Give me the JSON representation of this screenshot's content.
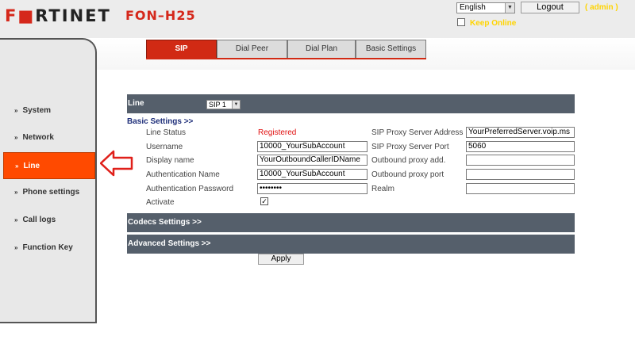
{
  "header": {
    "logo_main": "F",
    "logo_mid": "RTINET",
    "model": "FON–H25",
    "language": "English",
    "logout_label": "Logout",
    "user": "( admin )",
    "keep_online_label": "Keep Online"
  },
  "tabs": [
    {
      "label": "SIP",
      "active": true
    },
    {
      "label": "Dial Peer",
      "active": false
    },
    {
      "label": "Dial Plan",
      "active": false
    },
    {
      "label": "Basic Settings",
      "active": false
    }
  ],
  "sidebar": {
    "items": [
      {
        "label": "System"
      },
      {
        "label": "Network"
      },
      {
        "label": "Line",
        "active": true
      },
      {
        "label": "Phone settings"
      },
      {
        "label": "Call logs"
      },
      {
        "label": "Function Key"
      }
    ]
  },
  "line_section": {
    "title": "Line",
    "selected_line": "SIP 1"
  },
  "basic": {
    "title": "Basic Settings >>",
    "line_status_label": "Line Status",
    "line_status_value": "Registered",
    "username_label": "Username",
    "username_value": "10000_YourSubAccount",
    "display_name_label": "Display name",
    "display_name_value": "YourOutboundCallerIDName",
    "auth_name_label": "Authentication Name",
    "auth_name_value": "10000_YourSubAccount",
    "auth_password_label": "Authentication Password",
    "auth_password_value": "••••••••",
    "activate_label": "Activate",
    "activate_checked": true,
    "proxy_address_label": "SIP Proxy Server Address",
    "proxy_address_value": "YourPreferredServer.voip.ms",
    "proxy_port_label": "SIP Proxy Server Port",
    "proxy_port_value": "5060",
    "outbound_add_label": "Outbound proxy add.",
    "outbound_add_value": "",
    "outbound_port_label": "Outbound proxy port",
    "outbound_port_value": "",
    "realm_label": "Realm",
    "realm_value": ""
  },
  "codecs_title": "Codecs Settings >>",
  "advanced_title": "Advanced Settings >>",
  "apply_label": "Apply",
  "colors": {
    "brand_red": "#d12a14",
    "active_nav": "#ff4a00",
    "section_bar": "#555f6b",
    "status_red": "#e01010",
    "admin_yellow": "#ffd400"
  }
}
